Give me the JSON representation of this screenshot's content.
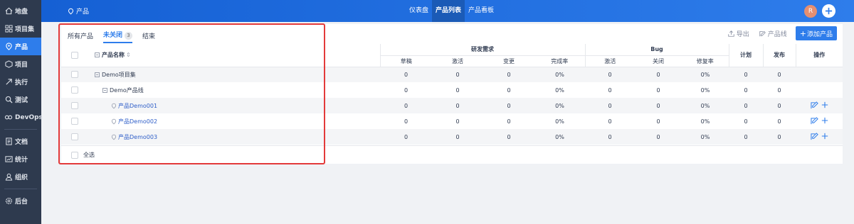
{
  "sidebar": {
    "items": [
      {
        "label": "地盘",
        "icon": "home-icon"
      },
      {
        "label": "项目集",
        "icon": "grid-icon"
      },
      {
        "label": "产品",
        "icon": "product-icon",
        "active": true
      },
      {
        "label": "项目",
        "icon": "project-icon"
      },
      {
        "label": "执行",
        "icon": "run-icon"
      },
      {
        "label": "测试",
        "icon": "test-icon"
      },
      {
        "label": "DevOps",
        "icon": "devops-icon"
      },
      {
        "label": "文档",
        "icon": "doc-icon"
      },
      {
        "label": "统计",
        "icon": "stats-icon"
      },
      {
        "label": "组织",
        "icon": "org-icon"
      },
      {
        "label": "后台",
        "icon": "gear-icon"
      }
    ]
  },
  "topbar": {
    "breadcrumb": "产品",
    "nav": [
      {
        "label": "仪表盘"
      },
      {
        "label": "产品列表",
        "active": true
      },
      {
        "label": "产品看板"
      }
    ],
    "avatar": "R"
  },
  "tabs": [
    {
      "label": "所有产品"
    },
    {
      "label": "未关闭",
      "count": "3",
      "active": true
    },
    {
      "label": "结束"
    }
  ],
  "actions": {
    "export": "导出",
    "product_line": "产品线",
    "add_product": "添加产品"
  },
  "table": {
    "header": {
      "name": "产品名称",
      "requirements_group": "研发需求",
      "bug_group": "Bug",
      "plan": "计划",
      "release": "发布",
      "ops": "操作",
      "sub": [
        "草稿",
        "激活",
        "变更",
        "完成率",
        "激活",
        "关闭",
        "修复率"
      ]
    },
    "rows": [
      {
        "name": "Demo项目集",
        "level": 0,
        "type": "program",
        "values": [
          "0",
          "0",
          "0",
          "0%",
          "0",
          "0",
          "0%",
          "0",
          "0"
        ]
      },
      {
        "name": "Demo产品线",
        "level": 1,
        "type": "line",
        "values": [
          "0",
          "0",
          "0",
          "0%",
          "0",
          "0",
          "0%",
          "0",
          "0"
        ]
      },
      {
        "name": "产品Demo001",
        "level": 2,
        "type": "product",
        "values": [
          "0",
          "0",
          "0",
          "0%",
          "0",
          "0",
          "0%",
          "0",
          "0"
        ]
      },
      {
        "name": "产品Demo002",
        "level": 2,
        "type": "product",
        "values": [
          "0",
          "0",
          "0",
          "0%",
          "0",
          "0",
          "0%",
          "0",
          "0"
        ]
      },
      {
        "name": "产品Demo003",
        "level": 2,
        "type": "product",
        "values": [
          "0",
          "0",
          "0",
          "0%",
          "0",
          "0",
          "0%",
          "0",
          "0"
        ]
      }
    ],
    "select_all": "全选"
  },
  "colors": {
    "accent": "#2e7deb",
    "sidebar": "#2e3a4e",
    "highlight_box": "#e33a3a"
  }
}
